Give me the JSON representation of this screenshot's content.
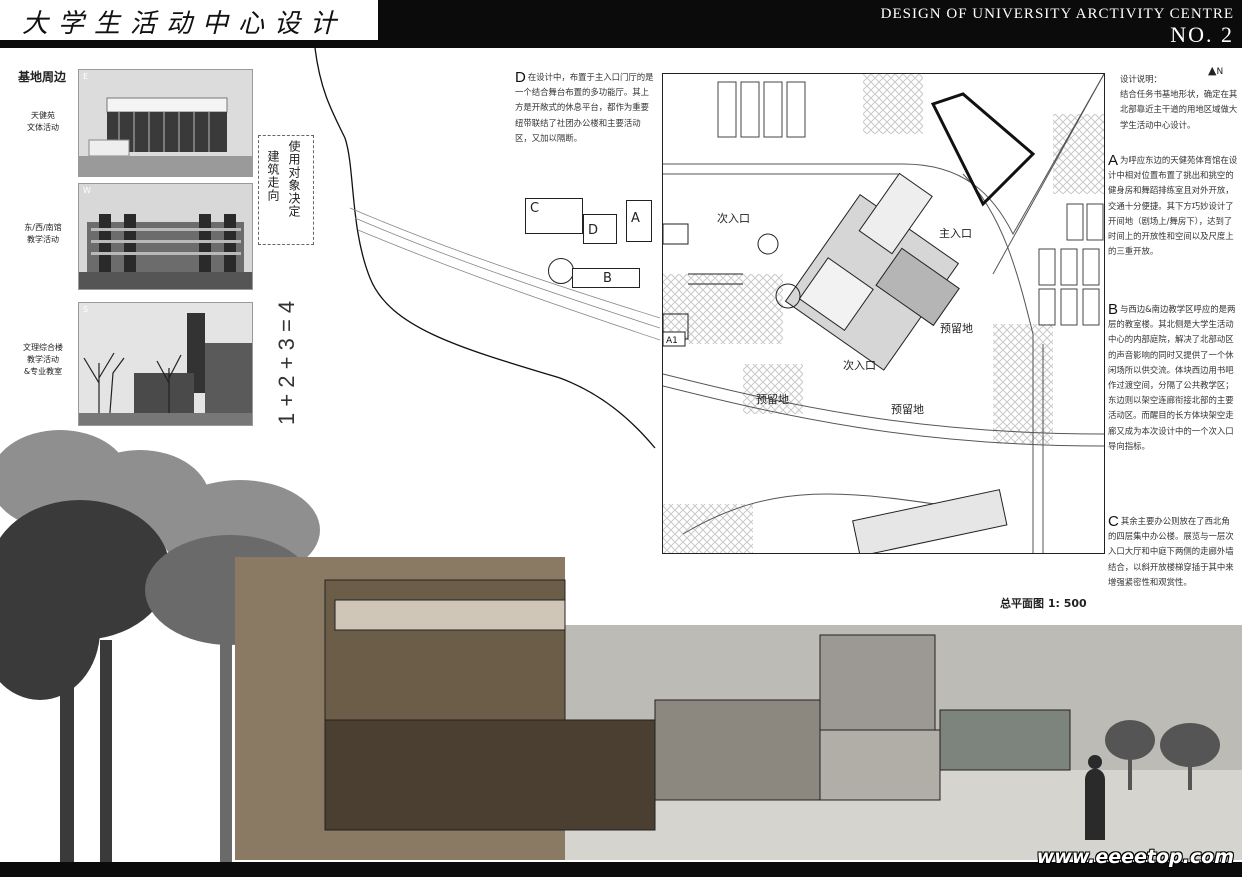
{
  "header": {
    "title_cn": "大学生活动中心设计",
    "title_en": "DESIGN OF UNIVERSITY ARCTIVITY CENTRE",
    "sheet_no": "NO. 2"
  },
  "site": {
    "heading": "基地周边",
    "photos": [
      {
        "letter": "E",
        "caption": "天健苑\n文体活动"
      },
      {
        "letter": "W",
        "caption": "东/西/南馆\n教学活动"
      },
      {
        "letter": "S",
        "caption": "文理综合楼\n教学活动\n&专业教室"
      }
    ]
  },
  "formula": {
    "vertical_1": "使用对象决定",
    "vertical_2": "建筑走向",
    "expression": "1 + 2 + 3 = 4"
  },
  "desc_d": {
    "letter": "D",
    "text": "在设计中，布置于主入口门厅的是一个结合舞台布置的多功能厅。其上方是开敞式的休息平台，都作为重要纽带联结了社团办公楼和主要活动区，又加以隔断。"
  },
  "diagram": {
    "a": "A",
    "b": "B",
    "c": "C",
    "d": "D",
    "a1": "A1"
  },
  "plan": {
    "north": "N",
    "labels": {
      "sec_entry_1": "次入口",
      "main_entry": "主入口",
      "sec_entry_2": "次入口",
      "reserved_1": "预留地",
      "reserved_2": "预留地",
      "reserved_3": "预留地"
    },
    "caption": "总平面图 1: 500"
  },
  "notes": {
    "intro_title": "设计说明：",
    "intro": "结合任务书基地形状，确定在其北部靠近主干道的用地区域做大学生活动中心设计。",
    "a_letter": "A",
    "a": "为呼应东边的天健苑体育馆在设计中相对位置布置了挑出和挑空的健身房和舞蹈排练室且对外开放，交通十分便捷。其下方巧妙设计了开间地（剧场上/舞房下），达到了时间上的开放性和空间以及尺度上的三重开放。",
    "b_letter": "B",
    "b": "与西边&南边教学区呼应的是两层的教室楼。其北侧是大学生活动中心的内部庭院，解决了北部动区的声音影响的同时又提供了一个休闲场所以供交流。体块西边用书吧作过渡空间，分隔了公共教学区；东边则以架空连廊衔接北部的主要活动区。而醒目的长方体块架空走廊又成为本次设计中的一个次入口导向指标。",
    "c_letter": "C",
    "c": "其余主要办公则放在了西北角的四层集中办公楼。展览与一层次入口大厅和中庭下两侧的走廊外墙结合，以斜开放楼梯穿插于其中来增强紧密性和观赏性。"
  },
  "watermark": "www.eeeetop.com",
  "colors": {
    "bar": "#0b0b0b",
    "ink": "#222222"
  }
}
